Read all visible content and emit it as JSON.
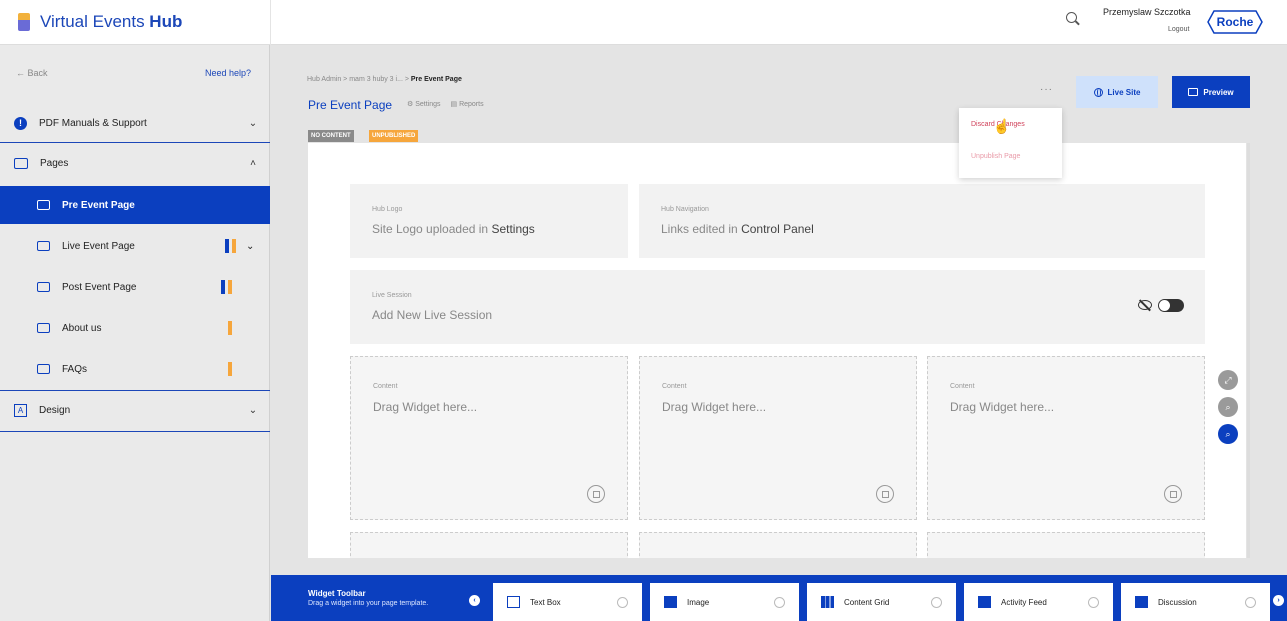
{
  "brand": {
    "name_light": "Virtual Events ",
    "name_bold": "Hub"
  },
  "sidebar": {
    "back": "← Back",
    "help": "Need help?",
    "manuals": "PDF Manuals & Support",
    "pages": "Pages",
    "sub_items": [
      {
        "label": "Pre Event Page"
      },
      {
        "label": "Live Event Page"
      },
      {
        "label": "Post Event Page"
      },
      {
        "label": "About us"
      },
      {
        "label": "FAQs"
      }
    ],
    "design": "Design"
  },
  "header": {
    "user": "Przemyslaw Szczotka",
    "logout": "Logout",
    "logo": "Roche"
  },
  "page": {
    "breadcrumb_prefix": "Hub Admin > mam 3 huby 3 i... > ",
    "breadcrumb_current": "Pre Event Page",
    "title": "Pre Event Page",
    "settings_link": "⚙ Settings",
    "reports_link": "▤ Reports",
    "badge_content": "NO CONTENT",
    "badge_status": "UNPUBLISHED",
    "more": "···",
    "live_site": "Live Site",
    "preview": "Preview"
  },
  "menu": {
    "discard": "Discard Changes",
    "unpublish": "Unpublish Page"
  },
  "canvas": {
    "hub_logo_caption": "Hub Logo",
    "hub_logo_text": "Site Logo uploaded in ",
    "hub_logo_bold": "Settings",
    "nav_caption": "Hub Navigation",
    "nav_text": "Links edited in ",
    "nav_bold": "Control Panel",
    "live_caption": "Live Session",
    "live_text": "Add New Live Session",
    "content_caption": "Content",
    "content_text": "Drag Widget here..."
  },
  "toolbar": {
    "title": "Widget Toolbar",
    "subtitle": "Drag a widget into your page template.",
    "widgets": [
      "Text Box",
      "Image",
      "Content Grid",
      "Activity Feed",
      "Discussion"
    ]
  },
  "colors": {
    "primary": "#0b3fbf",
    "accent": "#f6a63c",
    "danger": "#d0415a"
  }
}
